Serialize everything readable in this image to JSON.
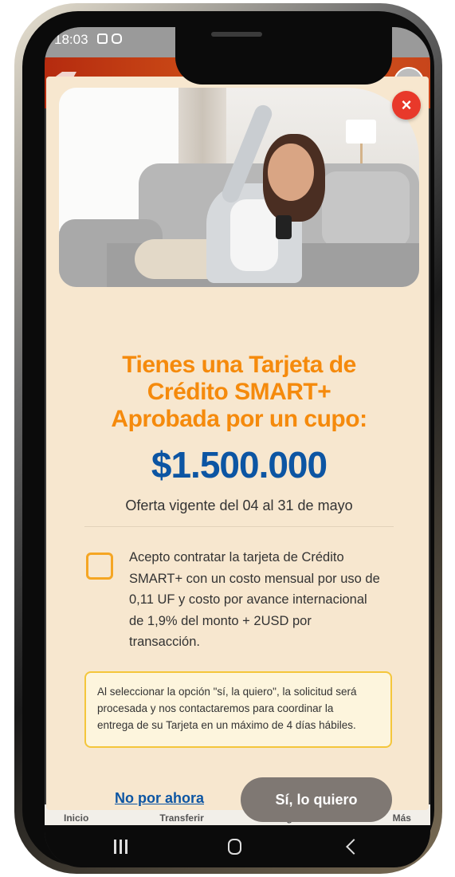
{
  "status_bar": {
    "time": "18:03"
  },
  "bottom_nav": {
    "items": [
      "Inicio",
      "Transferir",
      "Seguridad",
      "Más"
    ]
  },
  "modal": {
    "close_label": "×",
    "title_lines": [
      "Tienes una Tarjeta de",
      "Crédito SMART+",
      "Aprobada por un cupo:"
    ],
    "amount": "$1.500.000",
    "validity": "Oferta vigente del 04 al 31 de mayo",
    "checkbox_checked": false,
    "accept_lines": [
      "Acepto contratar la tarjeta de Crédito",
      "SMART+ con un costo mensual por uso de",
      "0,11 UF y costo por avance internacional",
      "de 1,9% del monto + 2USD por",
      "transacción."
    ],
    "notice_lines": [
      "Al seleccionar la opción \"sí, la quiero\", la solicitud será",
      "procesada y nos contactaremos para coordinar la",
      "entrega de su Tarjeta en un máximo de 4 días hábiles."
    ],
    "secondary_button": "No por ahora",
    "primary_button": "Sí, lo quiero"
  },
  "colors": {
    "title": "#f58a0c",
    "amount": "#0c55a3",
    "close": "#e8392a",
    "modal_bg": "#f7e7cf",
    "primary_button_bg": "#7f7873"
  }
}
